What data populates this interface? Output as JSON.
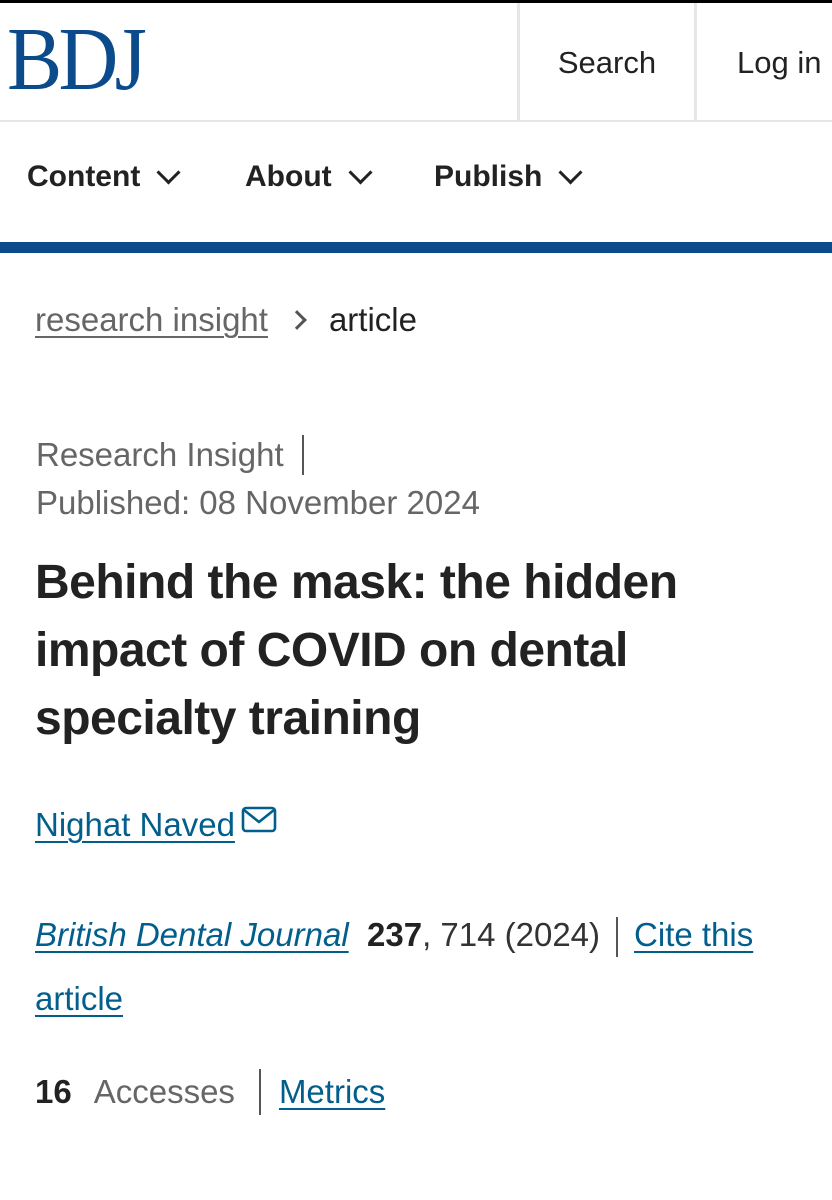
{
  "header": {
    "logo_text": "BDJ",
    "search_label": "Search",
    "login_label": "Log in"
  },
  "nav": {
    "items": [
      {
        "label": "Content",
        "icon": "chevron-down-icon"
      },
      {
        "label": "About",
        "icon": "chevron-down-icon"
      },
      {
        "label": "Publish",
        "icon": "chevron-down-icon"
      }
    ]
  },
  "breadcrumb": {
    "parent": "research insight",
    "separator_icon": "chevron-right-icon",
    "current": "article"
  },
  "article": {
    "type": "Research Insight",
    "published": "Published: 08 November 2024",
    "title": "Behind the mask: the hidden impact of COVID on dental specialty training",
    "author": "Nighat Naved",
    "author_icon": "mail-icon",
    "journal": "British Dental Journal",
    "volume": "237",
    "pages_year": ", 714 (2024)",
    "cite_label": "Cite this article",
    "accesses_count": "16",
    "accesses_label": "Accesses",
    "metrics_label": "Metrics"
  },
  "colors": {
    "brand": "#0b4a8b",
    "link": "#025e8d",
    "text": "#222222",
    "muted": "#666666"
  }
}
